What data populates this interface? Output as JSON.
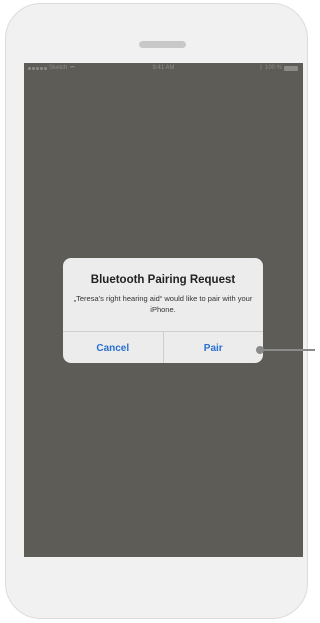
{
  "status_bar": {
    "carrier": "Sketch",
    "time": "9:41 AM",
    "battery": "100 %"
  },
  "dialog": {
    "title": "Bluetooth Pairing Request",
    "message": "„Teresa’s right hearing aid“ would like to pair with your iPhone.",
    "cancel_label": "Cancel",
    "pair_label": "Pair"
  },
  "colors": {
    "screen_background": "#5e5c56",
    "dialog_background": "#ececec",
    "button_text": "#2a6fd1",
    "callout": "#8a8a8a"
  },
  "icons": {
    "status_signal": "signal-dots-icon",
    "status_wifi": "wifi-icon",
    "status_bluetooth": "bluetooth-icon",
    "status_battery": "battery-icon"
  }
}
